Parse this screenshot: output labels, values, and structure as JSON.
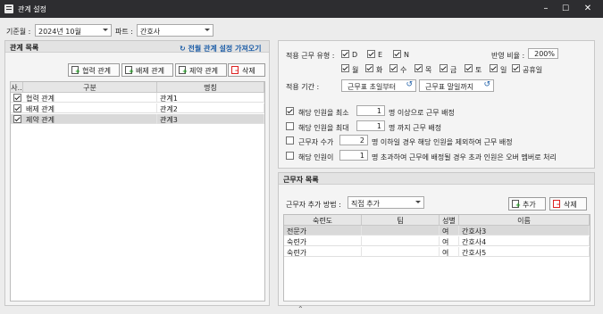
{
  "window": {
    "title": "관계 설정",
    "minimize": "–",
    "maximize": "☐",
    "close": "✕"
  },
  "top": {
    "month_label": "기준월 :",
    "month_value": "2024년 10월",
    "part_label": "파트 :",
    "part_value": "간호사"
  },
  "relations": {
    "title": "관계 목록",
    "import_link": "전월 관계 설정 가져오기",
    "buttons": {
      "cooperate": "협력 관계",
      "exclude": "배제 관계",
      "restrict": "제약 관계",
      "delete": "삭제"
    },
    "columns": {
      "use": "사..",
      "type": "구분",
      "name": "명칭"
    },
    "rows": [
      {
        "checked": true,
        "type": "협력 관계",
        "name": "관계1"
      },
      {
        "checked": true,
        "type": "배제 관계",
        "name": "관계2"
      },
      {
        "checked": true,
        "type": "제약 관계",
        "name": "관계3"
      }
    ]
  },
  "settings": {
    "duty_label": "적용 근무 유형 :",
    "duties": [
      "D",
      "E",
      "N"
    ],
    "ratio_label": "반영 비율 :",
    "ratio_value": "200%",
    "days": [
      "월",
      "화",
      "수",
      "목",
      "금",
      "토",
      "일",
      "공휴일"
    ],
    "period_label": "적용 기간 :",
    "period_start": "근무표 초일부터",
    "period_end": "근무표 말일까지",
    "rule1": {
      "checked": true,
      "prefix": "해당 인원을 최소",
      "value": "1",
      "suffix": "명 이상으로 근무 배정"
    },
    "rule2": {
      "checked": false,
      "prefix": "해당 인원을 최대",
      "value": "1",
      "suffix": "명 까지 근무 배정"
    },
    "rule3": {
      "checked": false,
      "prefix": "근무자 수가",
      "value": "2",
      "suffix": "명 이하일 경우 해당 인원을 제외하여 근무 배정"
    },
    "rule4": {
      "checked": false,
      "prefix": "해당 인원이",
      "value": "1",
      "suffix": "명 초과하여 근무에 배정될 경우 초과 인원은 오버 멤버로 처리"
    }
  },
  "workers": {
    "title": "근무자 목록",
    "method_label": "근무자 추가 방법 :",
    "method_value": "직접 추가",
    "add": "추가",
    "delete": "삭제",
    "columns": {
      "skill": "숙련도",
      "team": "팀",
      "gender": "성별",
      "name": "이름"
    },
    "rows": [
      {
        "skill": "전문가",
        "team": "",
        "gender": "여",
        "name": "간호사3"
      },
      {
        "skill": "숙련가",
        "team": "",
        "gender": "여",
        "name": "간호사4"
      },
      {
        "skill": "숙련가",
        "team": "",
        "gender": "여",
        "name": "간호사5"
      }
    ]
  },
  "footer": {
    "collapse": "⌃"
  }
}
